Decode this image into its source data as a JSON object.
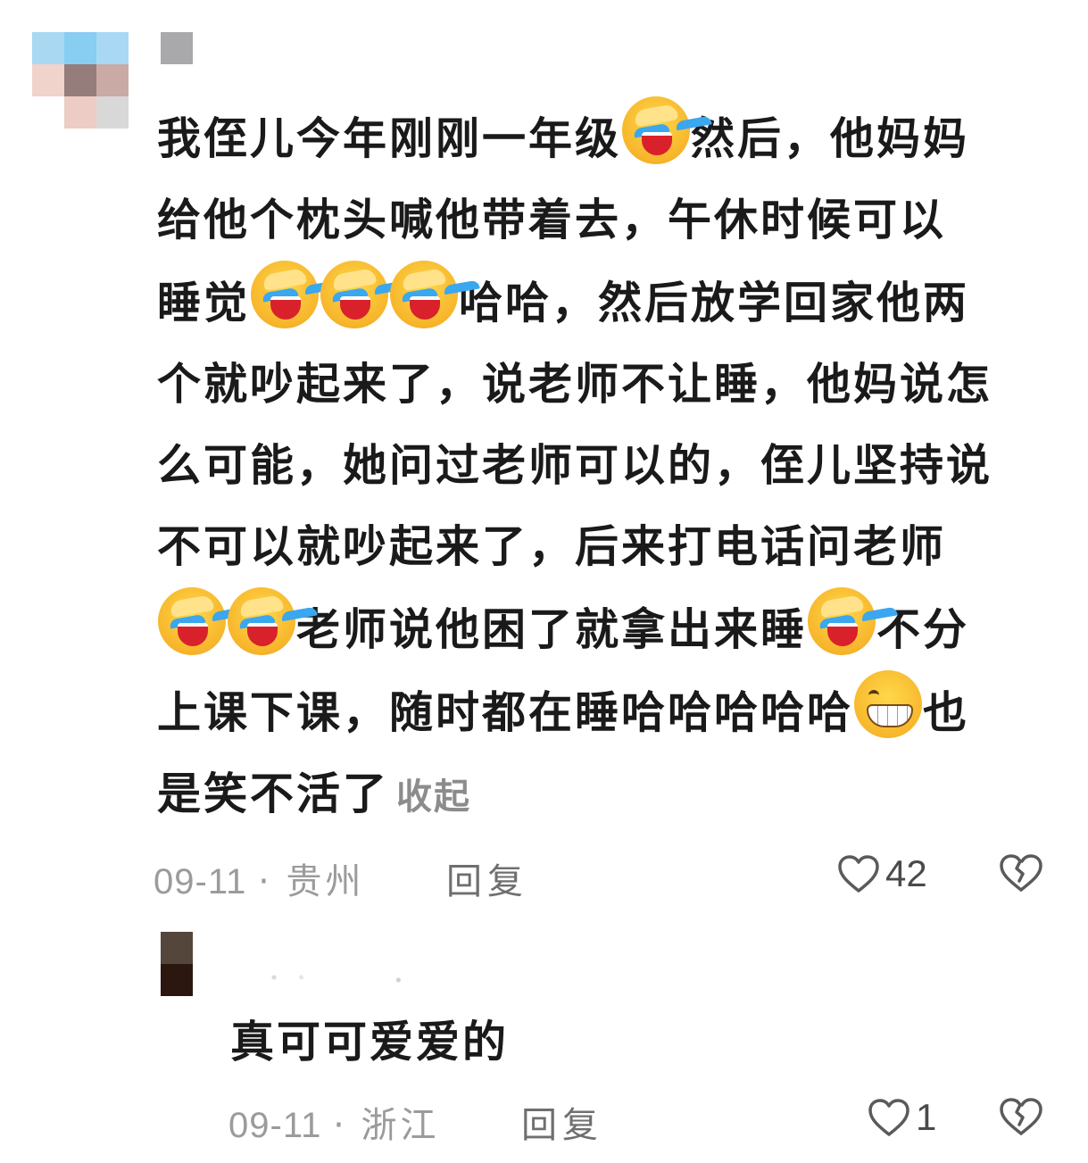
{
  "comment": {
    "lines": [
      [
        {
          "t": "我侄儿今年刚刚一年级"
        },
        {
          "e": "cry"
        },
        {
          "t": "然后，他妈妈"
        }
      ],
      [
        {
          "t": "给他个枕头喊他带着去，午休时候可以"
        }
      ],
      [
        {
          "t": "睡觉"
        },
        {
          "e": "cry"
        },
        {
          "e": "cry"
        },
        {
          "e": "cry"
        },
        {
          "t": "哈哈，然后放学回家他两"
        }
      ],
      [
        {
          "t": "个就吵起来了，说老师不让睡，他妈说怎"
        }
      ],
      [
        {
          "t": "么可能，她问过老师可以的，侄儿坚持说"
        }
      ],
      [
        {
          "t": "不可以就吵起来了，后来打电话问老师"
        }
      ],
      [
        {
          "e": "cry"
        },
        {
          "e": "cry"
        },
        {
          "t": "老师说他困了就拿出来睡"
        },
        {
          "e": "cry"
        },
        {
          "t": "不分"
        }
      ],
      [
        {
          "t": "上课下课，随时都在睡哈哈哈哈哈"
        },
        {
          "e": "grin"
        },
        {
          "t": "也"
        }
      ],
      [
        {
          "t": "是笑不活了"
        }
      ]
    ],
    "collapse_label": "收起",
    "date": "09-11",
    "separator": "·",
    "location": "贵州",
    "reply_label": "回复",
    "like_count": "42"
  },
  "reply": {
    "text": "真可可爱爱的",
    "date": "09-11",
    "separator": "·",
    "location": "浙江",
    "reply_label": "回复",
    "like_count": "1"
  },
  "icons": {
    "emoji_cry": "laughing-crying-face-icon",
    "emoji_grin": "grinning-face-icon",
    "like": "heart-outline-icon",
    "dislike": "broken-heart-icon"
  },
  "colors": {
    "text": "#1a1a1a",
    "meta": "#9b9b9b",
    "reply_button": "#6f6f6f",
    "avatar_main": [
      "#a9d8f2",
      "#88cdf2",
      "#a8d8f4",
      "#f0d3cb",
      "#957d7c",
      "#c9aaa4",
      "#ffffff",
      "#ecccc4",
      "#d8d8d8"
    ],
    "avatar_reply": [
      "#54463b",
      "#2b1710"
    ]
  }
}
